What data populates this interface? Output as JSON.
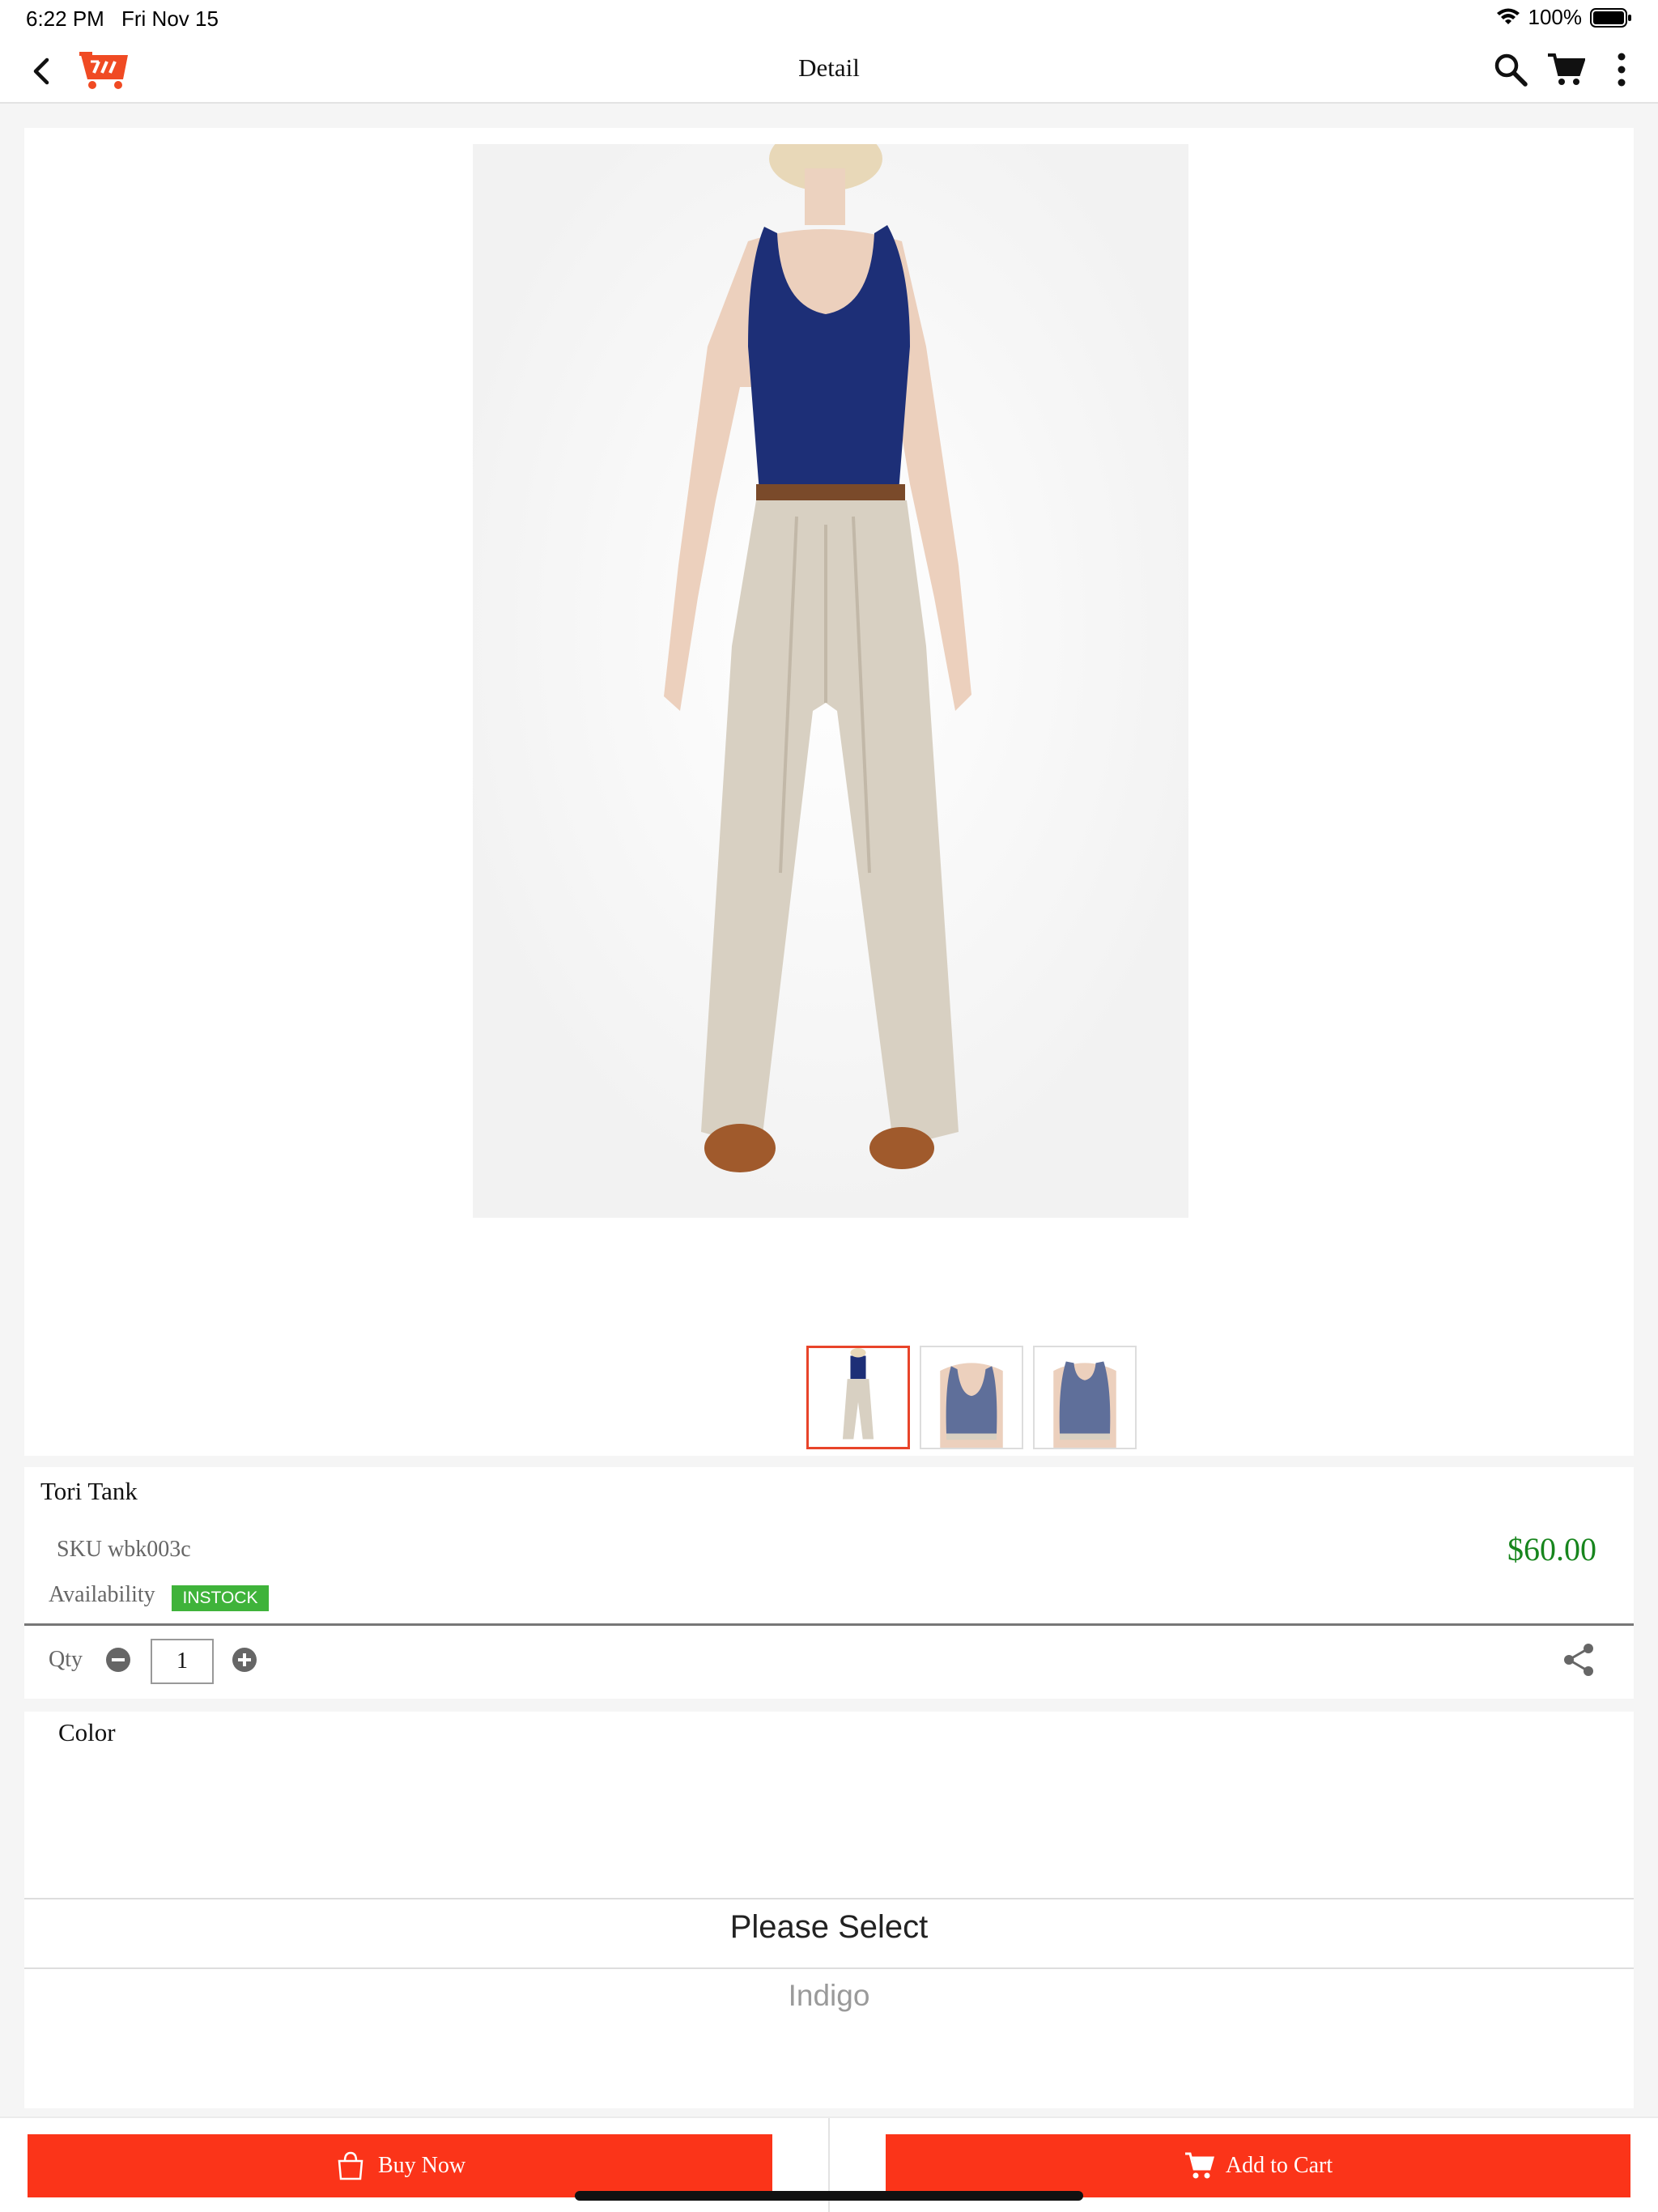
{
  "status_bar": {
    "time": "6:22 PM",
    "date": "Fri Nov 15",
    "battery": "100%"
  },
  "nav": {
    "title": "Detail"
  },
  "product": {
    "name": "Tori Tank",
    "sku": "SKU wbk003c",
    "price": "$60.00",
    "availability_label": "Availability",
    "availability_status": "INSTOCK",
    "qty_label": "Qty",
    "qty_value": "1"
  },
  "options": {
    "color_label": "Color",
    "picker_selected": "Please Select",
    "picker_option": "Indigo"
  },
  "actions": {
    "buy_now": "Buy Now",
    "add_to_cart": "Add to Cart"
  },
  "colors": {
    "accent": "#fb3419",
    "price": "#17851d",
    "instock": "#3fb33a",
    "tank": "#1d2f77",
    "pants": "#d8d0c2"
  }
}
